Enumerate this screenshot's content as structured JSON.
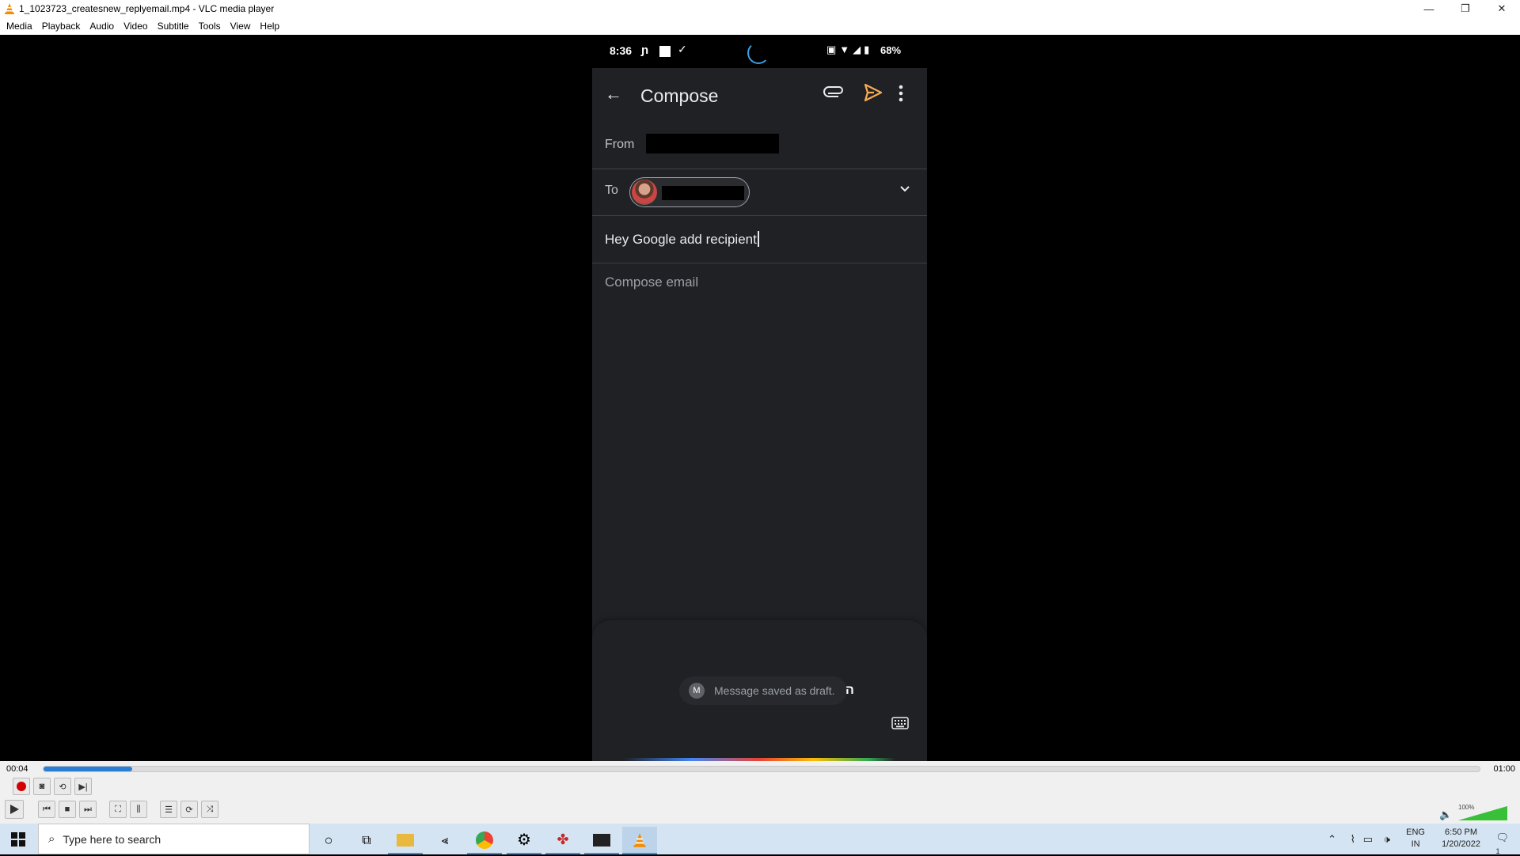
{
  "window": {
    "title": "1_1023723_createsnew_replyemail.mp4 - VLC media player",
    "minimize": "—",
    "restore": "❐",
    "close": "✕"
  },
  "menu": [
    "Media",
    "Playback",
    "Audio",
    "Video",
    "Subtitle",
    "Tools",
    "View",
    "Help"
  ],
  "phone": {
    "status": {
      "time": "8:36",
      "battery": "68%"
    },
    "appbar": {
      "title": "Compose"
    },
    "from_label": "From",
    "to_label": "To",
    "subject": "Hey Google add recipient",
    "body_placeholder": "Compose email",
    "toast": "Message saved as draft.",
    "assistant_char": "ה"
  },
  "player": {
    "elapsed": "00:04",
    "total": "01:00",
    "progress_fraction": 0.0615,
    "volume_label": "100%",
    "volume_fraction": 1.0
  },
  "taskbar": {
    "search_placeholder": "Type here to search",
    "lang_top": "ENG",
    "lang_bottom": "IN",
    "time": "6:50 PM",
    "date": "1/20/2022",
    "notification_count": "1"
  },
  "colors": {
    "accent": "#2a7fd4",
    "gmail_accent": "#f6ad55",
    "phone_bg": "#202124"
  }
}
